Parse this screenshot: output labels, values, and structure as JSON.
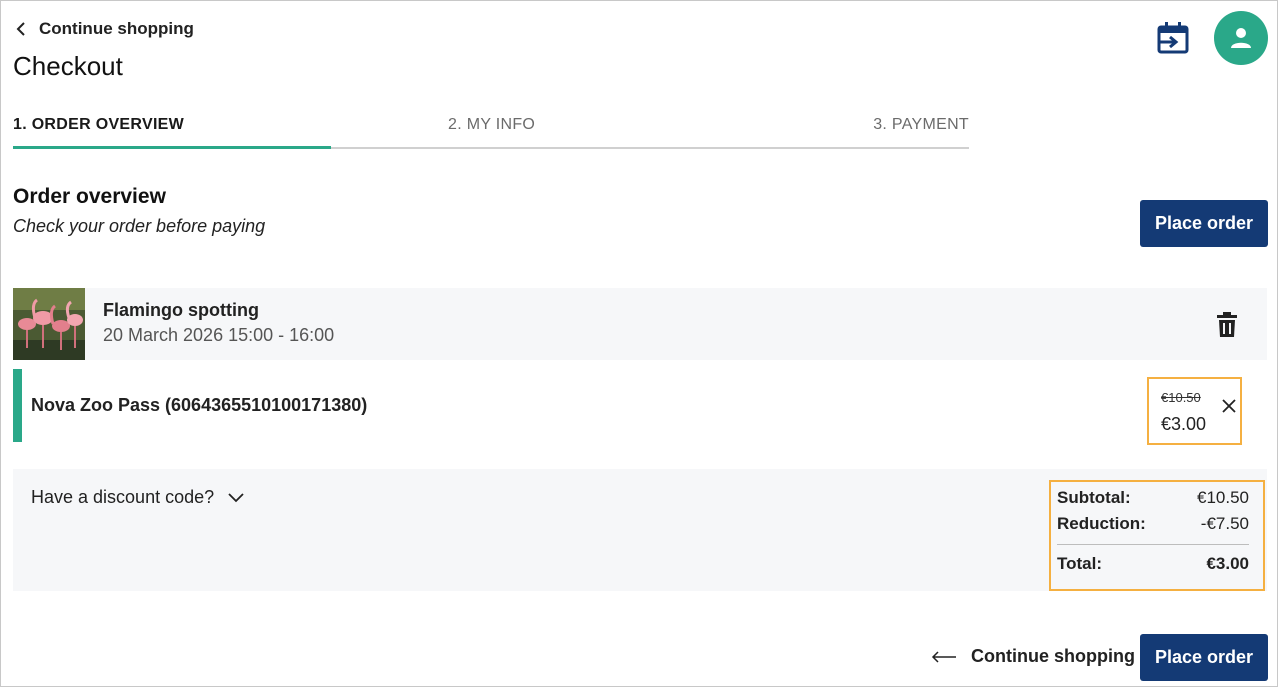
{
  "header": {
    "back_label": "Continue shopping",
    "title": "Checkout",
    "icons": {
      "calendar": "calendar-import-icon",
      "account": "person-icon"
    },
    "accent_color": "#2aa889"
  },
  "steps": [
    {
      "label": "1. ORDER OVERVIEW",
      "active": true
    },
    {
      "label": "2. MY INFO",
      "active": false
    },
    {
      "label": "3. PAYMENT",
      "active": false
    }
  ],
  "overview": {
    "title": "Order overview",
    "subtitle": "Check your order before paying",
    "place_order_label": "Place order"
  },
  "order_item": {
    "name": "Flamingo spotting",
    "datetime": "20 March 2026 15:00 - 16:00",
    "ticket": {
      "name": "Nova Zoo Pass (6064365510100171380)",
      "original_price": "€10.50",
      "price": "€3.00"
    }
  },
  "discount": {
    "label": "Have a discount code?"
  },
  "totals": {
    "subtotal_label": "Subtotal:",
    "subtotal_value": "€10.50",
    "reduction_label": "Reduction:",
    "reduction_value": "-€7.50",
    "total_label": "Total:",
    "total_value": "€3.00"
  },
  "footer": {
    "back_label": "Continue shopping",
    "place_order_label": "Place order"
  },
  "colors": {
    "primary": "#143a75",
    "highlight": "#f5b041",
    "panel": "#f6f7f9"
  }
}
